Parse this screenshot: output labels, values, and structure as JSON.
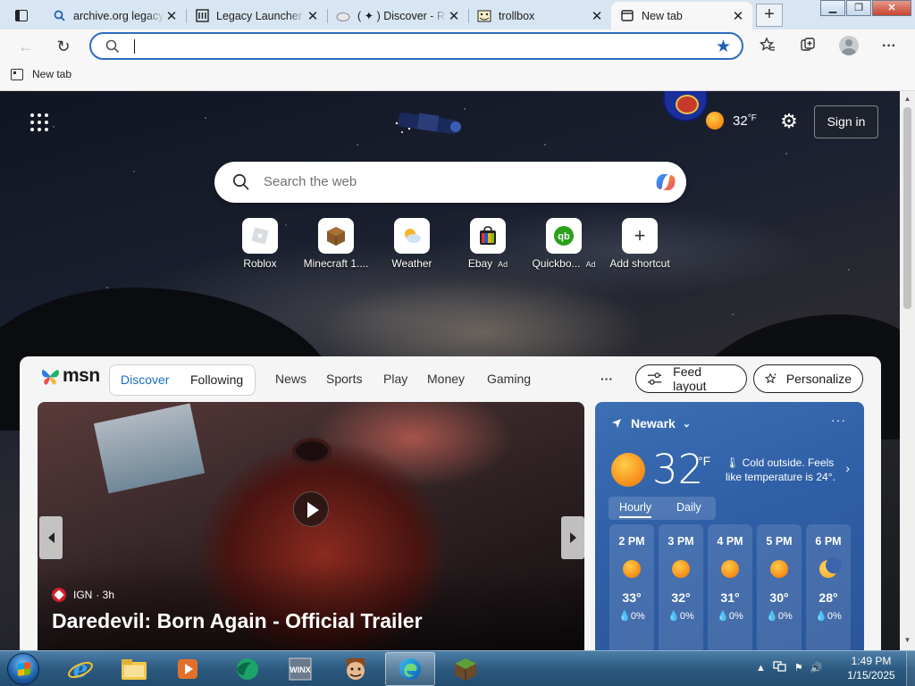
{
  "browser": {
    "tabs": [
      {
        "title": "archive.org legacy",
        "icon": "search-icon",
        "active": false
      },
      {
        "title": "Legacy Launcher",
        "icon": "archive-icon",
        "active": false
      },
      {
        "title": "( ✦ ) Discover - R",
        "icon": "cloud-icon",
        "active": false
      },
      {
        "title": "trollbox",
        "icon": "trollface-icon",
        "active": false
      },
      {
        "title": "New tab",
        "icon": "newtab-icon",
        "active": true
      }
    ],
    "new_tab_symbol": "+",
    "window_controls": {
      "minimize": "▁",
      "maximize": "❐",
      "close": "✕"
    },
    "address": {
      "value": "",
      "placeholder": ""
    },
    "favorites": [
      {
        "label": "New tab"
      }
    ]
  },
  "newtab": {
    "weather_temp": "32",
    "weather_unit": "°F",
    "sign_in": "Sign in",
    "search_placeholder": "Search the web",
    "quick_links": [
      {
        "label": "Roblox",
        "ad": ""
      },
      {
        "label": "Minecraft 1....",
        "ad": ""
      },
      {
        "label": "Weather",
        "ad": ""
      },
      {
        "label": "Ebay",
        "ad": "Ad"
      },
      {
        "label": "Quickbo...",
        "ad": "Ad"
      },
      {
        "label": "Add shortcut",
        "ad": ""
      }
    ]
  },
  "feed": {
    "brand": "msn",
    "tabs": [
      "Discover",
      "Following"
    ],
    "links": [
      "News",
      "Sports",
      "Play",
      "Money",
      "Gaming"
    ],
    "more": "···",
    "feed_layout": "Feed layout",
    "personalize": "Personalize",
    "hero": {
      "source": "IGN",
      "age": "· 3h",
      "headline": "Daredevil: Born Again - Official Trailer"
    },
    "weather": {
      "location": "Newark",
      "temp": "32",
      "unit": "°F",
      "note": "Cold outside. Feels like temperature is 24°.",
      "tabs": [
        "Hourly",
        "Daily"
      ],
      "hours": [
        {
          "time": "2 PM",
          "temp": "33°",
          "precip": "0%",
          "icon": "sun-icon"
        },
        {
          "time": "3 PM",
          "temp": "32°",
          "precip": "0%",
          "icon": "sun-icon"
        },
        {
          "time": "4 PM",
          "temp": "31°",
          "precip": "0%",
          "icon": "sun-icon"
        },
        {
          "time": "5 PM",
          "temp": "30°",
          "precip": "0%",
          "icon": "sun-icon"
        },
        {
          "time": "6 PM",
          "temp": "28°",
          "precip": "0%",
          "icon": "moon-icon"
        }
      ]
    }
  },
  "taskbar": {
    "apps": [
      "internet-explorer-icon",
      "file-explorer-icon",
      "media-player-icon",
      "app-icon",
      "app-icon",
      "trollface-icon",
      "edge-icon",
      "minecraft-icon"
    ],
    "time": "1:49 PM",
    "date": "1/15/2025"
  }
}
